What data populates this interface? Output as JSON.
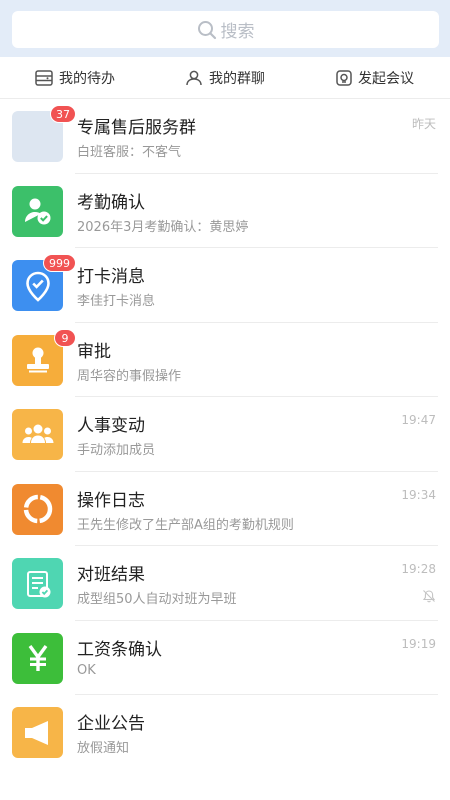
{
  "search": {
    "placeholder": "搜索"
  },
  "tabs": [
    {
      "label": "我的待办",
      "icon": "todo-icon"
    },
    {
      "label": "我的群聊",
      "icon": "group-chat-icon"
    },
    {
      "label": "发起会议",
      "icon": "meeting-icon"
    }
  ],
  "messages": [
    {
      "title": "专属售后服务群",
      "subtitle": "白班客服：不客气",
      "time": "昨天",
      "badge": "37",
      "icon": "group-avatar-icon",
      "color": "#dde6f1"
    },
    {
      "title": "考勤确认",
      "subtitle": "2026年3月考勤确认：黄思婷",
      "time": "",
      "badge": "",
      "icon": "attendance-confirm-icon",
      "color": "#3cc06a"
    },
    {
      "title": "打卡消息",
      "subtitle": "李佳打卡消息",
      "time": "",
      "badge": "999",
      "icon": "checkin-location-icon",
      "color": "#3d8ff0"
    },
    {
      "title": "审批",
      "subtitle": "周华容的事假操作",
      "time": "",
      "badge": "9",
      "icon": "approval-stamp-icon",
      "color": "#f6ad3b"
    },
    {
      "title": "人事变动",
      "subtitle": "手动添加成员",
      "time": "19:47",
      "badge": "",
      "icon": "personnel-change-icon",
      "color": "#f7b548"
    },
    {
      "title": "操作日志",
      "subtitle": "王先生修改了生产部A组的考勤机规则",
      "time": "19:34",
      "badge": "",
      "icon": "operation-log-icon",
      "color": "#f08a30"
    },
    {
      "title": "对班结果",
      "subtitle": "成型组50人自动对班为早班",
      "time": "19:28",
      "badge": "",
      "icon": "shift-result-icon",
      "color": "#4fd6b2",
      "muted": true
    },
    {
      "title": "工资条确认",
      "subtitle": "OK",
      "time": "19:19",
      "badge": "",
      "icon": "payslip-yen-icon",
      "color": "#3dbe3a"
    },
    {
      "title": "企业公告",
      "subtitle": "放假通知",
      "time": "",
      "badge": "",
      "icon": "announcement-icon",
      "color": "#f7b548"
    }
  ]
}
